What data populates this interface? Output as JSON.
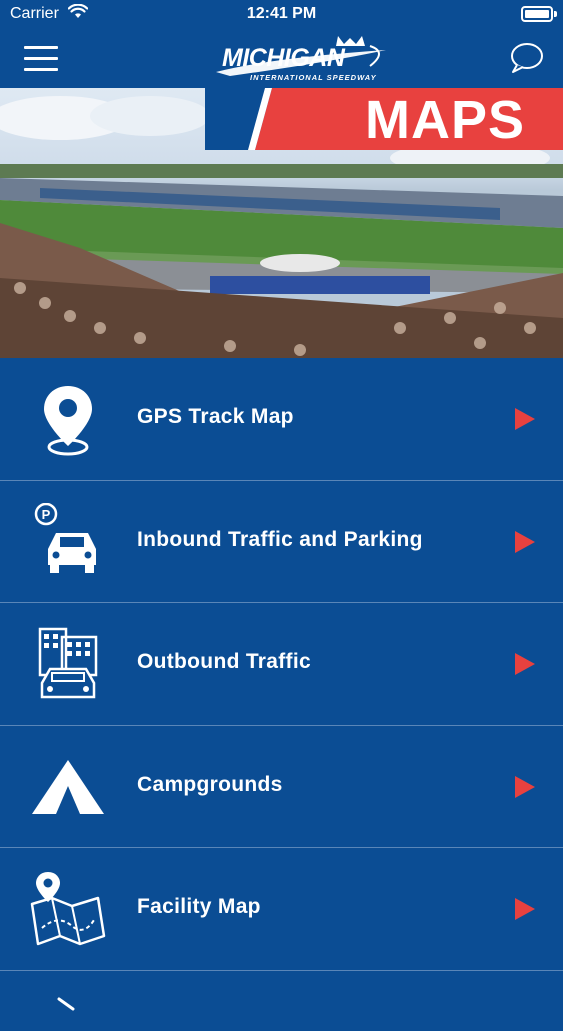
{
  "status_bar": {
    "carrier": "Carrier",
    "time": "12:41 PM"
  },
  "nav": {
    "logo_main": "MICHIGAN",
    "logo_sub": "INTERNATIONAL SPEEDWAY",
    "menu_icon": "hamburger-icon",
    "chat_icon": "chat-bubble-icon"
  },
  "hero": {
    "banner_title": "MAPS",
    "banner_red": "#e8413f",
    "banner_blue": "#0b4d94"
  },
  "menu": {
    "items": [
      {
        "label": "GPS Track Map",
        "icon": "location-pin-icon"
      },
      {
        "label": "Inbound Traffic and Parking",
        "icon": "car-parking-icon"
      },
      {
        "label": "Outbound Traffic",
        "icon": "car-city-icon"
      },
      {
        "label": "Campgrounds",
        "icon": "tent-icon"
      },
      {
        "label": "Facility Map",
        "icon": "folded-map-icon"
      }
    ]
  },
  "colors": {
    "background": "#0b4d94",
    "accent": "#e8413f",
    "divider": "#5a86b8"
  }
}
